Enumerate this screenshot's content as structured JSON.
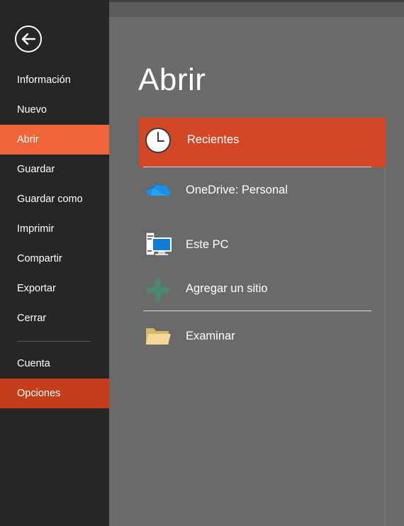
{
  "sidebar": {
    "back_icon": "arrow-left-circle-icon",
    "items": [
      {
        "label": "Información"
      },
      {
        "label": "Nuevo"
      },
      {
        "label": "Abrir"
      },
      {
        "label": "Guardar"
      },
      {
        "label": "Guardar como"
      },
      {
        "label": "Imprimir"
      },
      {
        "label": "Compartir"
      },
      {
        "label": "Exportar"
      },
      {
        "label": "Cerrar"
      },
      {
        "label": "Cuenta"
      },
      {
        "label": "Opciones"
      }
    ],
    "selected": "Abrir",
    "highlighted": "Opciones"
  },
  "main": {
    "title": "Abrir",
    "places": [
      {
        "label": "Recientes",
        "icon": "clock-icon",
        "active": true
      },
      {
        "label": "OneDrive: Personal",
        "icon": "onedrive-cloud-icon",
        "active": false
      },
      {
        "label": "Este PC",
        "icon": "computer-icon",
        "active": false
      },
      {
        "label": "Agregar un sitio",
        "icon": "plus-icon",
        "active": false
      },
      {
        "label": "Examinar",
        "icon": "folder-icon",
        "active": false
      }
    ]
  },
  "colors": {
    "sidebar_bg": "#262626",
    "selected_bg": "#f0643a",
    "active_place_bg": "#d24726",
    "main_bg": "#6a6a6a"
  }
}
